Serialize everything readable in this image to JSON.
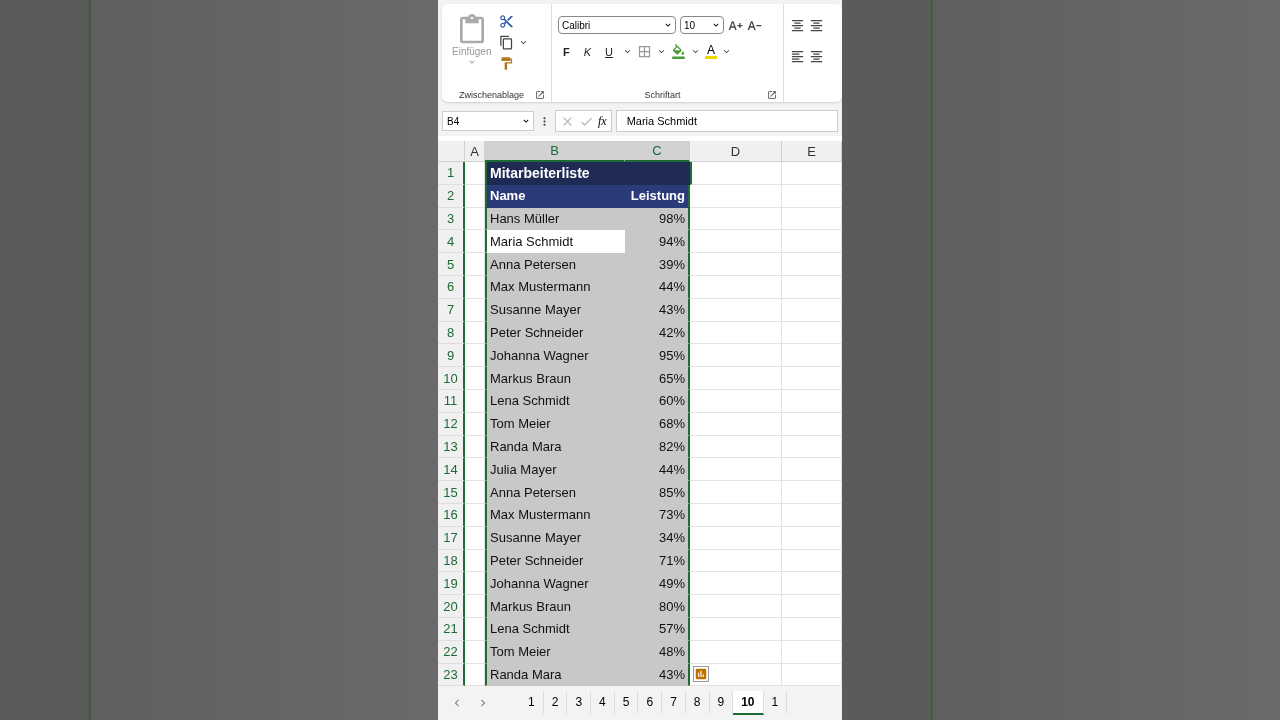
{
  "ribbon": {
    "clipboard": {
      "paste_label": "Einfügen",
      "group_label": "Zwischenablage"
    },
    "font": {
      "font_name": "Calibri",
      "font_size": "10",
      "bold": "F",
      "italic": "K",
      "underline": "U",
      "font_color": "A",
      "group_label": "Schriftart"
    }
  },
  "formula_bar": {
    "name_box": "B4",
    "fx": "fx",
    "content": "Maria Schmidt"
  },
  "columns": [
    {
      "label": "A",
      "selected": false
    },
    {
      "label": "B",
      "selected": true
    },
    {
      "label": "C",
      "selected": true
    },
    {
      "label": "D",
      "selected": false
    },
    {
      "label": "E",
      "selected": false
    }
  ],
  "sheet": {
    "title_row": "1",
    "title": "Mitarbeiterliste",
    "header_row": "2",
    "headers": [
      "Name",
      "Leistung"
    ],
    "rows": [
      {
        "number": "3",
        "name": "Hans Müller",
        "score": "98%",
        "active": false
      },
      {
        "number": "4",
        "name": "Maria Schmidt",
        "score": "94%",
        "active": true
      },
      {
        "number": "5",
        "name": "Anna Petersen",
        "score": "39%",
        "active": false
      },
      {
        "number": "6",
        "name": "Max Mustermann",
        "score": "44%",
        "active": false
      },
      {
        "number": "7",
        "name": "Susanne Mayer",
        "score": "43%",
        "active": false
      },
      {
        "number": "8",
        "name": "Peter Schneider",
        "score": "42%",
        "active": false
      },
      {
        "number": "9",
        "name": "Johanna Wagner",
        "score": "95%",
        "active": false
      },
      {
        "number": "10",
        "name": "Markus Braun",
        "score": "65%",
        "active": false
      },
      {
        "number": "11",
        "name": "Lena Schmidt",
        "score": "60%",
        "active": false
      },
      {
        "number": "12",
        "name": "Tom Meier",
        "score": "68%",
        "active": false
      },
      {
        "number": "13",
        "name": "Randa Mara",
        "score": "82%",
        "active": false
      },
      {
        "number": "14",
        "name": "Julia Mayer",
        "score": "44%",
        "active": false
      },
      {
        "number": "15",
        "name": "Anna Petersen",
        "score": "85%",
        "active": false
      },
      {
        "number": "16",
        "name": "Max Mustermann",
        "score": "73%",
        "active": false
      },
      {
        "number": "17",
        "name": "Susanne Mayer",
        "score": "34%",
        "active": false
      },
      {
        "number": "18",
        "name": "Peter Schneider",
        "score": "71%",
        "active": false
      },
      {
        "number": "19",
        "name": "Johanna Wagner",
        "score": "49%",
        "active": false
      },
      {
        "number": "20",
        "name": "Markus Braun",
        "score": "80%",
        "active": false
      },
      {
        "number": "21",
        "name": "Lena Schmidt",
        "score": "57%",
        "active": false
      },
      {
        "number": "22",
        "name": "Tom Meier",
        "score": "48%",
        "active": false
      },
      {
        "number": "23",
        "name": "Randa Mara",
        "score": "43%",
        "active": false
      }
    ]
  },
  "sheet_tabs": [
    {
      "label": "1",
      "selected": false
    },
    {
      "label": "2",
      "selected": false
    },
    {
      "label": "3",
      "selected": false
    },
    {
      "label": "4",
      "selected": false
    },
    {
      "label": "5",
      "selected": false
    },
    {
      "label": "6",
      "selected": false
    },
    {
      "label": "7",
      "selected": false
    },
    {
      "label": "8",
      "selected": false
    },
    {
      "label": "9",
      "selected": false
    },
    {
      "label": "10",
      "selected": true
    },
    {
      "label": "1",
      "selected": false
    }
  ]
}
